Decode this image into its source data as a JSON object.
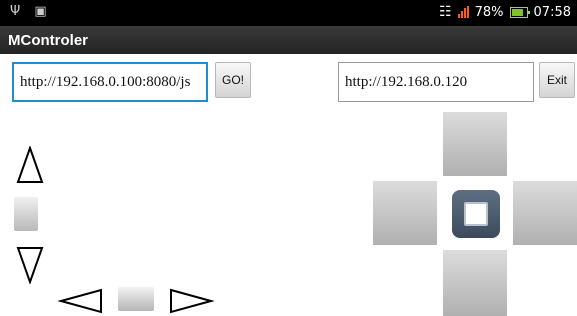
{
  "statusbar": {
    "usb_icon": "usb-icon",
    "android_icon": "android-debug-icon",
    "battery_percent": "78%",
    "time": "07:58"
  },
  "app": {
    "title": "MControler"
  },
  "form": {
    "url_left": "http://192.168.0.100:8080/js",
    "go_label": "GO!",
    "url_right": "http://192.168.0.120",
    "exit_label": "Exit"
  },
  "controls": {
    "up_arrow_icon": "up-triangle-outline",
    "down_arrow_icon": "down-triangle-outline",
    "left_arrow_icon": "left-triangle-outline",
    "right_arrow_icon": "right-triangle-outline"
  }
}
